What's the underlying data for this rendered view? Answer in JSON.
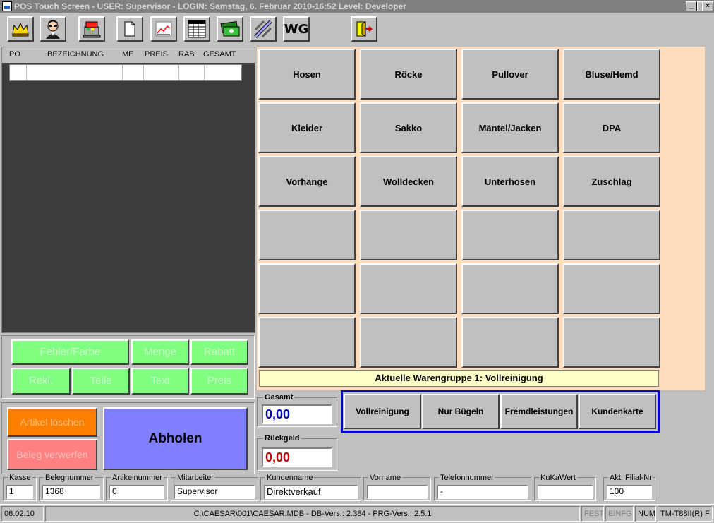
{
  "window": {
    "title": "POS Touch Screen - USER: Supervisor - LOGIN: Samstag, 6. Februar 2010-16:52 Level: Developer",
    "minimize_label": "_",
    "maximize_label": "▫",
    "close_label": "×"
  },
  "toolbar": {
    "items": [
      {
        "icon": "crown-icon"
      },
      {
        "icon": "user-sunglasses-icon"
      },
      {
        "icon": "cash-register-icon"
      },
      {
        "icon": "document-icon"
      },
      {
        "icon": "line-chart-icon"
      },
      {
        "icon": "table-icon"
      },
      {
        "icon": "money-icon"
      },
      {
        "icon": "tools-icon"
      },
      {
        "icon": "wg-text",
        "label": "WG"
      },
      {
        "icon": "exit-door-icon"
      }
    ]
  },
  "receipt": {
    "columns": [
      "PO",
      "BEZEICHNUNG",
      "ME",
      "PREIS",
      "RAB",
      "GESAMT"
    ]
  },
  "functions": {
    "fehler_farbe": "Fehler/Farbe",
    "menge": "Menge",
    "rabatt": "Rabatt",
    "rekl": "Rekl.",
    "teile": "Teile",
    "text": "Text",
    "preis": "Preis"
  },
  "actions": {
    "artikel_loeschen": "Artikel löschen",
    "beleg_verwerfen": "Beleg verwerfen",
    "abholen": "Abholen"
  },
  "products": [
    "Hosen",
    "Röcke",
    "Pullover",
    "Bluse/Hemd",
    "Kleider",
    "Sakko",
    "Mäntel/Jacken",
    "DPA",
    "Vorhänge",
    "Wolldecken",
    "Unterhosen",
    "Zuschlag",
    "",
    "",
    "",
    "",
    "",
    "",
    "",
    "",
    "",
    "",
    "",
    ""
  ],
  "current_group": "Aktuelle Warengruppe 1: Vollreinigung",
  "totals": {
    "gesamt_label": "Gesamt",
    "gesamt_value": "0,00",
    "rueckgeld_label": "Rückgeld",
    "rueckgeld_value": "0,00"
  },
  "services": [
    "Vollreinigung",
    "Nur Bügeln",
    "Fremdleistungen",
    "Kundenkarte"
  ],
  "fields": {
    "kasse": {
      "label": "Kasse",
      "value": "1"
    },
    "belegnummer": {
      "label": "Belegnummer",
      "value": "1368"
    },
    "artikelnummer": {
      "label": "Artikelnummer",
      "value": "0"
    },
    "mitarbeiter": {
      "label": "Mitarbeiter",
      "value": "Supervisor"
    },
    "kundenname": {
      "label": "Kundenname",
      "value": "Direktverkauf"
    },
    "vorname": {
      "label": "Vorname",
      "value": ""
    },
    "telefonnummer": {
      "label": "Telefonnummer",
      "value": "-"
    },
    "kukawert": {
      "label": "KuKaWert",
      "value": ""
    },
    "filial_nr": {
      "label": "Akt. Filial-Nr",
      "value": "100"
    }
  },
  "status": {
    "date": "06.02.10",
    "db_info": "C:\\CAESAR\\001\\CAESAR.MDB - DB-Vers.:  2.384 - PRG-Vers.: 2.5.1",
    "fest": "FEST",
    "einfg": "EINFG",
    "num": "NUM",
    "printer": "TM-T88II(R) F"
  },
  "colors": {
    "function_green": "#80ff80",
    "delete_orange": "#ff8000",
    "discard_pink": "#ff8080",
    "abholen_blue": "#8080ff",
    "money_blue": "#0000c0",
    "money_red": "#c00000",
    "grid_bg": "#ffdcbe",
    "service_border": "#0000c8"
  }
}
